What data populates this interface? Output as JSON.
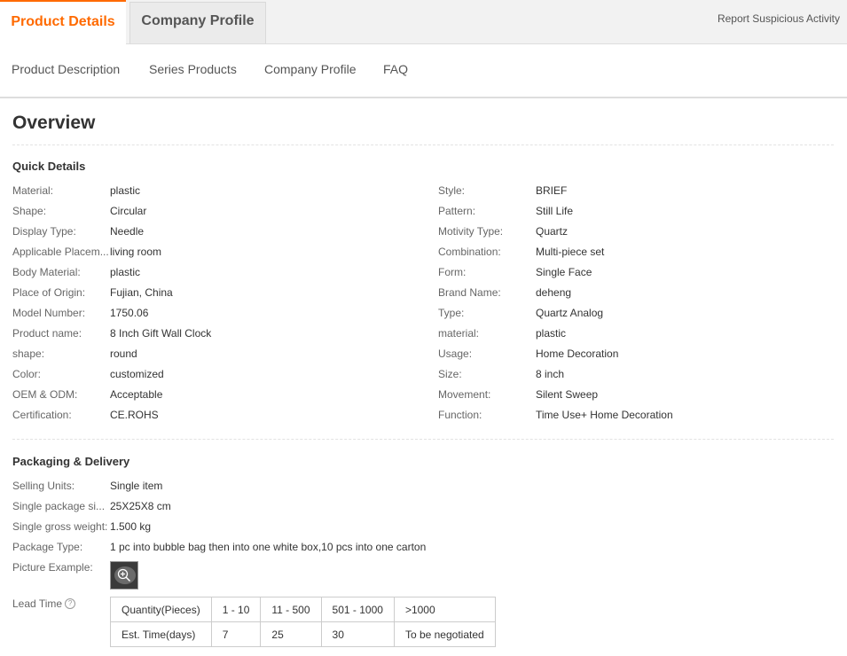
{
  "tabs": {
    "product_details": "Product Details",
    "company_profile": "Company Profile"
  },
  "report_link": "Report Suspicious Activity",
  "subnav": [
    "Product Description",
    "Series Products",
    "Company Profile",
    "FAQ"
  ],
  "overview_title": "Overview",
  "quick_details": {
    "title": "Quick Details",
    "left": [
      {
        "name": "Material:",
        "value": "plastic"
      },
      {
        "name": "Shape:",
        "value": "Circular"
      },
      {
        "name": "Display Type:",
        "value": "Needle"
      },
      {
        "name": "Applicable Placem...",
        "value": "living room"
      },
      {
        "name": "Body Material:",
        "value": "plastic"
      },
      {
        "name": "Place of Origin:",
        "value": "Fujian, China"
      },
      {
        "name": "Model Number:",
        "value": "1750.06"
      },
      {
        "name": "Product name:",
        "value": "8 Inch Gift Wall Clock"
      },
      {
        "name": "shape:",
        "value": "round"
      },
      {
        "name": "Color:",
        "value": "customized"
      },
      {
        "name": "OEM & ODM:",
        "value": "Acceptable"
      },
      {
        "name": "Certification:",
        "value": "CE.ROHS"
      }
    ],
    "right": [
      {
        "name": "Style:",
        "value": "BRIEF"
      },
      {
        "name": "Pattern:",
        "value": "Still Life"
      },
      {
        "name": "Motivity Type:",
        "value": "Quartz"
      },
      {
        "name": "Combination:",
        "value": "Multi-piece set"
      },
      {
        "name": "Form:",
        "value": "Single Face"
      },
      {
        "name": "Brand Name:",
        "value": "deheng"
      },
      {
        "name": "Type:",
        "value": "Quartz Analog"
      },
      {
        "name": "material:",
        "value": "plastic"
      },
      {
        "name": "Usage:",
        "value": "Home Decoration"
      },
      {
        "name": "Size:",
        "value": "8 inch"
      },
      {
        "name": "Movement:",
        "value": "Silent Sweep"
      },
      {
        "name": "Function:",
        "value": "Time Use+ Home Decoration"
      }
    ]
  },
  "packaging": {
    "title": "Packaging & Delivery",
    "rows": [
      {
        "name": "Selling Units:",
        "value": "Single item"
      },
      {
        "name": "Single package si...",
        "value": "25X25X8 cm"
      },
      {
        "name": "Single gross weight:",
        "value": "1.500 kg"
      },
      {
        "name": "Package Type:",
        "value": "1 pc into bubble bag then into one white box,10 pcs into one carton"
      }
    ],
    "picture_label": "Picture Example:",
    "lead_time_label": "Lead Time",
    "lead_table": {
      "header": [
        "Quantity(Pieces)",
        "1 - 10",
        "11 - 500",
        "501 - 1000",
        ">1000"
      ],
      "row": [
        "Est. Time(days)",
        "7",
        "25",
        "30",
        "To be negotiated"
      ]
    }
  },
  "colors": {
    "accent": "#ff6a00"
  },
  "icons": {
    "help": "question-circle-icon",
    "zoom": "zoom-in-icon"
  }
}
